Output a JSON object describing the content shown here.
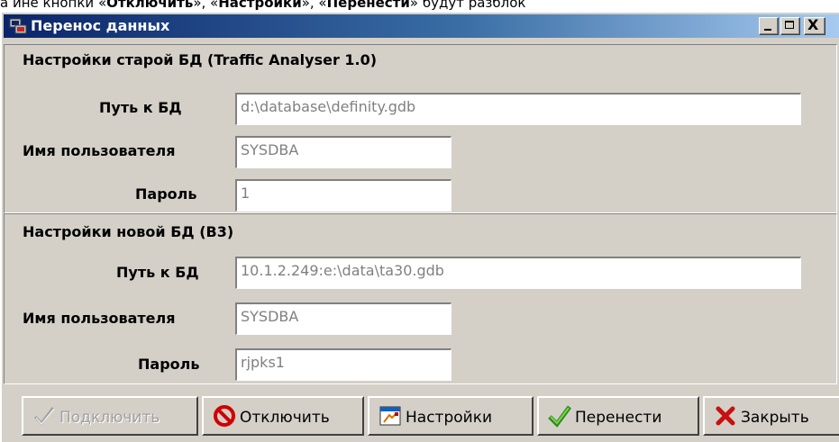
{
  "document_text": {
    "prefix": "а ине кнопки «",
    "b1": "Отключить",
    "mid1": "», «",
    "b2": "Настройки",
    "mid2": "», «",
    "b3": "Перенести",
    "suffix": "» будут разблок"
  },
  "window": {
    "title": "Перенос данных",
    "minimize_label": "_",
    "close_label": "X"
  },
  "old_db": {
    "section_title": "Настройки старой БД  (Traffic Analyser 1.0)",
    "path_label": "Путь к БД",
    "path_value": "d:\\database\\definity.gdb",
    "user_label": "Имя пользователя",
    "user_value": "SYSDBA",
    "password_label": "Пароль",
    "password_value": "1"
  },
  "new_db": {
    "section_title": "Настройки новой БД  (B3)",
    "path_label": "Путь к БД",
    "path_value": "10.1.2.249:e:\\data\\ta30.gdb",
    "user_label": "Имя пользователя",
    "user_value": "SYSDBA",
    "password_label": "Пароль",
    "password_value": "rjpks1"
  },
  "toolbar": {
    "connect_label": "Подключить",
    "disconnect_label": "Отключить",
    "settings_label": "Настройки",
    "transfer_label": "Перенести",
    "close_label": "Закрыть"
  },
  "icons": {
    "connect": "check-icon",
    "disconnect": "no-entry-icon",
    "settings": "settings-window-icon",
    "transfer": "green-check-icon",
    "close": "red-x-icon"
  },
  "colors": {
    "titlebar_start": "#0a246a",
    "titlebar_end": "#a6caf0",
    "window_bg": "#d4d0c8",
    "disabled_text": "#a0a0a0",
    "field_text": "#808080"
  }
}
